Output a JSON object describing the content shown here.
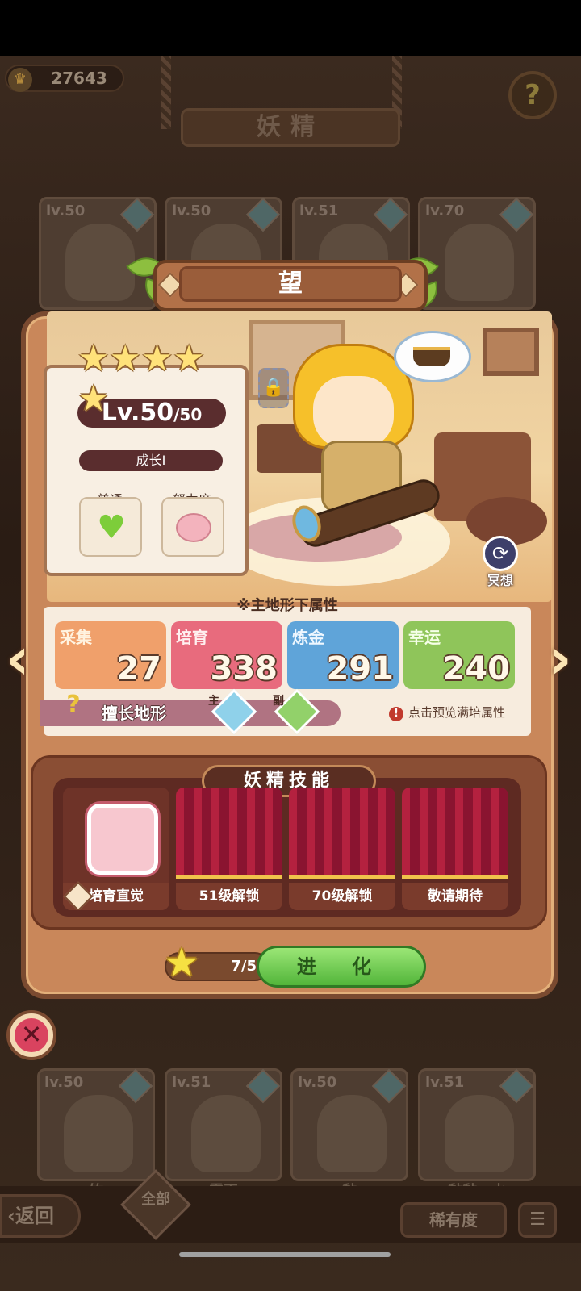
{
  "topbar": {
    "coins": "27643",
    "title": "妖精"
  },
  "background_cards_top": [
    {
      "level": "lv.50"
    },
    {
      "level": "lv.50"
    },
    {
      "level": "lv.51"
    },
    {
      "level": "lv.70"
    }
  ],
  "background_cards_bottom": [
    {
      "level": "lv.50",
      "name": "竹"
    },
    {
      "level": "lv.51",
      "name": "霞再"
    },
    {
      "level": "lv.50",
      "name": "黏"
    },
    {
      "level": "lv.51",
      "name": "黏黏・水"
    }
  ],
  "fairy": {
    "name": "望",
    "stars": 5,
    "level": "Lv.50",
    "level_max": "/50",
    "growth": "成长I",
    "trait1_label": "普通",
    "trait2_label": "努力度",
    "meditate_label": "冥想"
  },
  "attributes": {
    "header": "※主地形下属性",
    "stats": [
      {
        "label": "采集",
        "value": "27",
        "color": "#f0a06b"
      },
      {
        "label": "培育",
        "value": "338",
        "color": "#e86b7d"
      },
      {
        "label": "炼金",
        "value": "291",
        "color": "#5fa4d9"
      },
      {
        "label": "幸运",
        "value": "240",
        "color": "#8fc55a"
      }
    ],
    "terrain_label": "擅长地形",
    "terrain_main_tag": "主",
    "terrain_sub_tag": "副",
    "hint": "点击预览满培属性"
  },
  "skills": {
    "title": "妖精技能",
    "slots": [
      {
        "label": "培育直觉"
      },
      {
        "label": "51级解锁"
      },
      {
        "label": "70级解锁"
      },
      {
        "label": "敬请期待"
      }
    ]
  },
  "evolve": {
    "progress": "7/5",
    "button": "进 化"
  },
  "bottom": {
    "back": "返回",
    "all": "全部",
    "rarity": "稀有度"
  }
}
